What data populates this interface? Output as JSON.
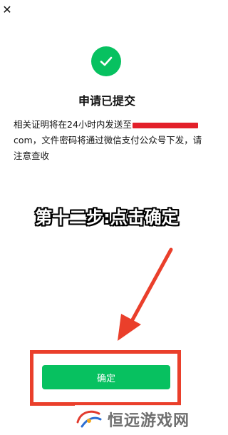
{
  "header": {
    "close_icon": "close-icon"
  },
  "result": {
    "icon": "check-circle-icon",
    "icon_color": "#07c160",
    "title": "申请已提交",
    "message_part1": "相关证明将在24小时内发送至",
    "message_part2": "com，文件密码将通过微信支付公众号下发，请注意查收"
  },
  "annotation": {
    "step_caption": "第十二步:点击确定",
    "arrow_color": "#ea3f2b",
    "highlight_color": "#ea3f2b"
  },
  "actions": {
    "confirm_label": "确定",
    "confirm_color": "#07c160"
  },
  "watermark": {
    "text": "恒远游戏网"
  }
}
